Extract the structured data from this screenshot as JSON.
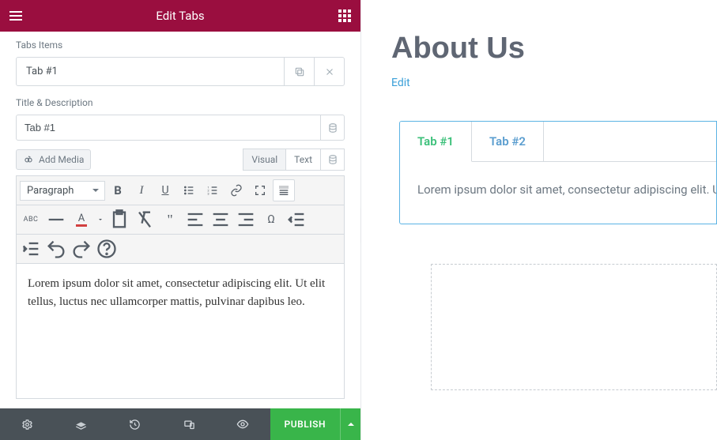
{
  "panel": {
    "header_title": "Edit Tabs",
    "tabs_items_label": "Tabs Items",
    "item_title": "Tab #1",
    "title_desc_label": "Title & Description",
    "title_input_value": "Tab #1",
    "add_media_label": "Add Media",
    "mode_visual": "Visual",
    "mode_text": "Text",
    "format_dropdown": "Paragraph",
    "editor_content": "Lorem ipsum dolor sit amet, consectetur adipiscing elit. Ut elit tellus, luctus nec ullamcorper mattis, pulvinar dapibus leo.",
    "toolbar_abc": "ABC"
  },
  "bottom": {
    "publish_label": "PUBLISH"
  },
  "preview": {
    "heading": "About Us",
    "edit_link": "Edit",
    "tabs": [
      {
        "label": "Tab #1",
        "active": true
      },
      {
        "label": "Tab #2",
        "active": false
      }
    ],
    "tab_content": "Lorem ipsum dolor sit amet, consectetur adipiscing elit. Ut elit"
  },
  "colors": {
    "brand": "#9a0e3f",
    "publish": "#39b54a",
    "active_tab": "#3cc07a",
    "preview_border": "#5bb3e4"
  }
}
